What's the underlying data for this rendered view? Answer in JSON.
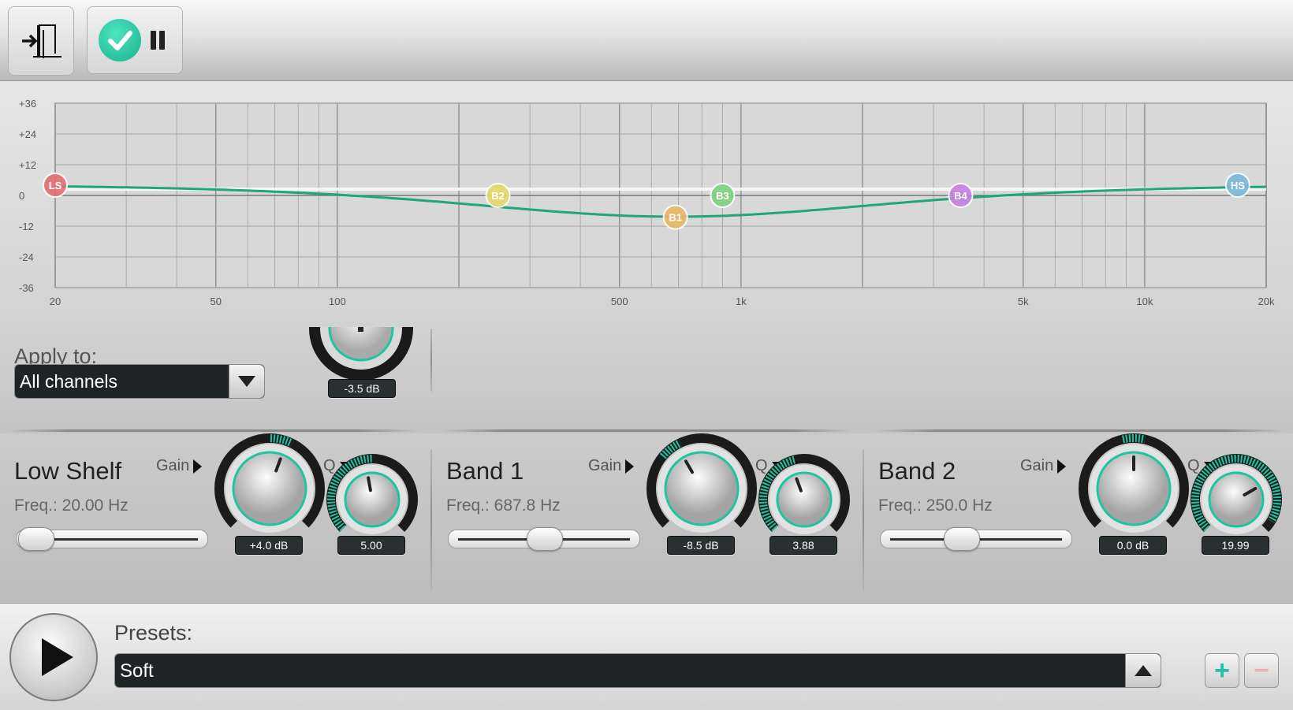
{
  "toolbar": {
    "exit_icon": "exit-door-icon",
    "status_icon": "checkmark-icon",
    "pause_icon": "pause-icon"
  },
  "graph": {
    "y_labels": [
      "+36",
      "+24",
      "+12",
      "0",
      "-12",
      "-24",
      "-36"
    ],
    "x_labels": [
      "20",
      "50",
      "100",
      "500",
      "1k",
      "5k",
      "10k",
      "20k"
    ],
    "nodes": [
      {
        "label": "LS",
        "freq": 20,
        "gain": 4.0,
        "color": "#e36f6f"
      },
      {
        "label": "B2",
        "freq": 250,
        "gain": 0,
        "color": "#e6d96a"
      },
      {
        "label": "B1",
        "freq": 687.8,
        "gain": -8.5,
        "color": "#e8b865"
      },
      {
        "label": "B3",
        "freq": 900,
        "gain": 0,
        "color": "#7fd27f"
      },
      {
        "label": "B4",
        "freq": 3500,
        "gain": 0,
        "color": "#c57fe0"
      },
      {
        "label": "HS",
        "freq": 17000,
        "gain": 4.0,
        "color": "#79b9da"
      }
    ],
    "curve_color": "#1fa67a"
  },
  "apply": {
    "label": "Apply to:",
    "value": "All channels"
  },
  "master": {
    "gain_value": "-3.5 dB"
  },
  "bands": [
    {
      "title": "Low Shelf",
      "gain_label": "Gain",
      "q_label": "Q",
      "freq": "Freq.: 20.00 Hz",
      "gain_value": "+4.0 dB",
      "q_value": "5.00",
      "slider": 0.0
    },
    {
      "title": "Band 1",
      "gain_label": "Gain",
      "q_label": "Q",
      "freq": "Freq.: 687.8 Hz",
      "gain_value": "-8.5 dB",
      "q_value": "3.88",
      "slider": 0.5
    },
    {
      "title": "Band 2",
      "gain_label": "Gain",
      "q_label": "Q",
      "freq": "Freq.: 250.0 Hz",
      "gain_value": "0.0 dB",
      "q_value": "19.99",
      "slider": 0.4
    }
  ],
  "footer": {
    "presets_label": "Presets:",
    "preset_value": "Soft",
    "add_label": "+",
    "remove_label": "−"
  },
  "colors": {
    "accent": "#1fc4a0"
  }
}
